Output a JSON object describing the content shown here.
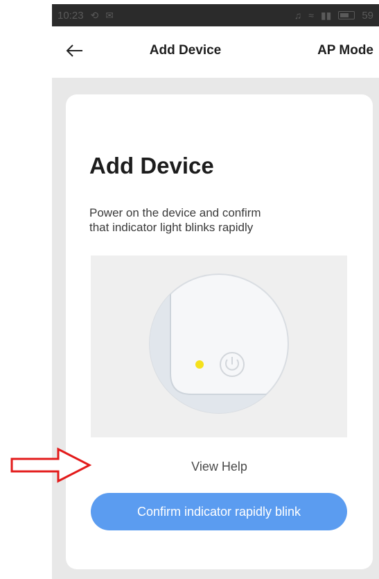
{
  "status_bar": {
    "time": "10:23",
    "battery": "59"
  },
  "header": {
    "title": "Add Device",
    "mode_link": "AP Mode"
  },
  "card": {
    "title": "Add Device",
    "description_line1": "Power on the device and confirm",
    "description_line2": "that indicator light blinks rapidly",
    "view_help": "View Help",
    "confirm_button": "Confirm indicator rapidly blink"
  },
  "colors": {
    "button_blue": "#5b9cf0",
    "indicator_yellow": "#f5e11c",
    "arrow_red": "#e31b1b",
    "content_gray": "#e8e8e8"
  },
  "icons": {
    "back": "arrow-left-icon",
    "power": "power-icon",
    "pointer": "red-outline-arrow"
  }
}
